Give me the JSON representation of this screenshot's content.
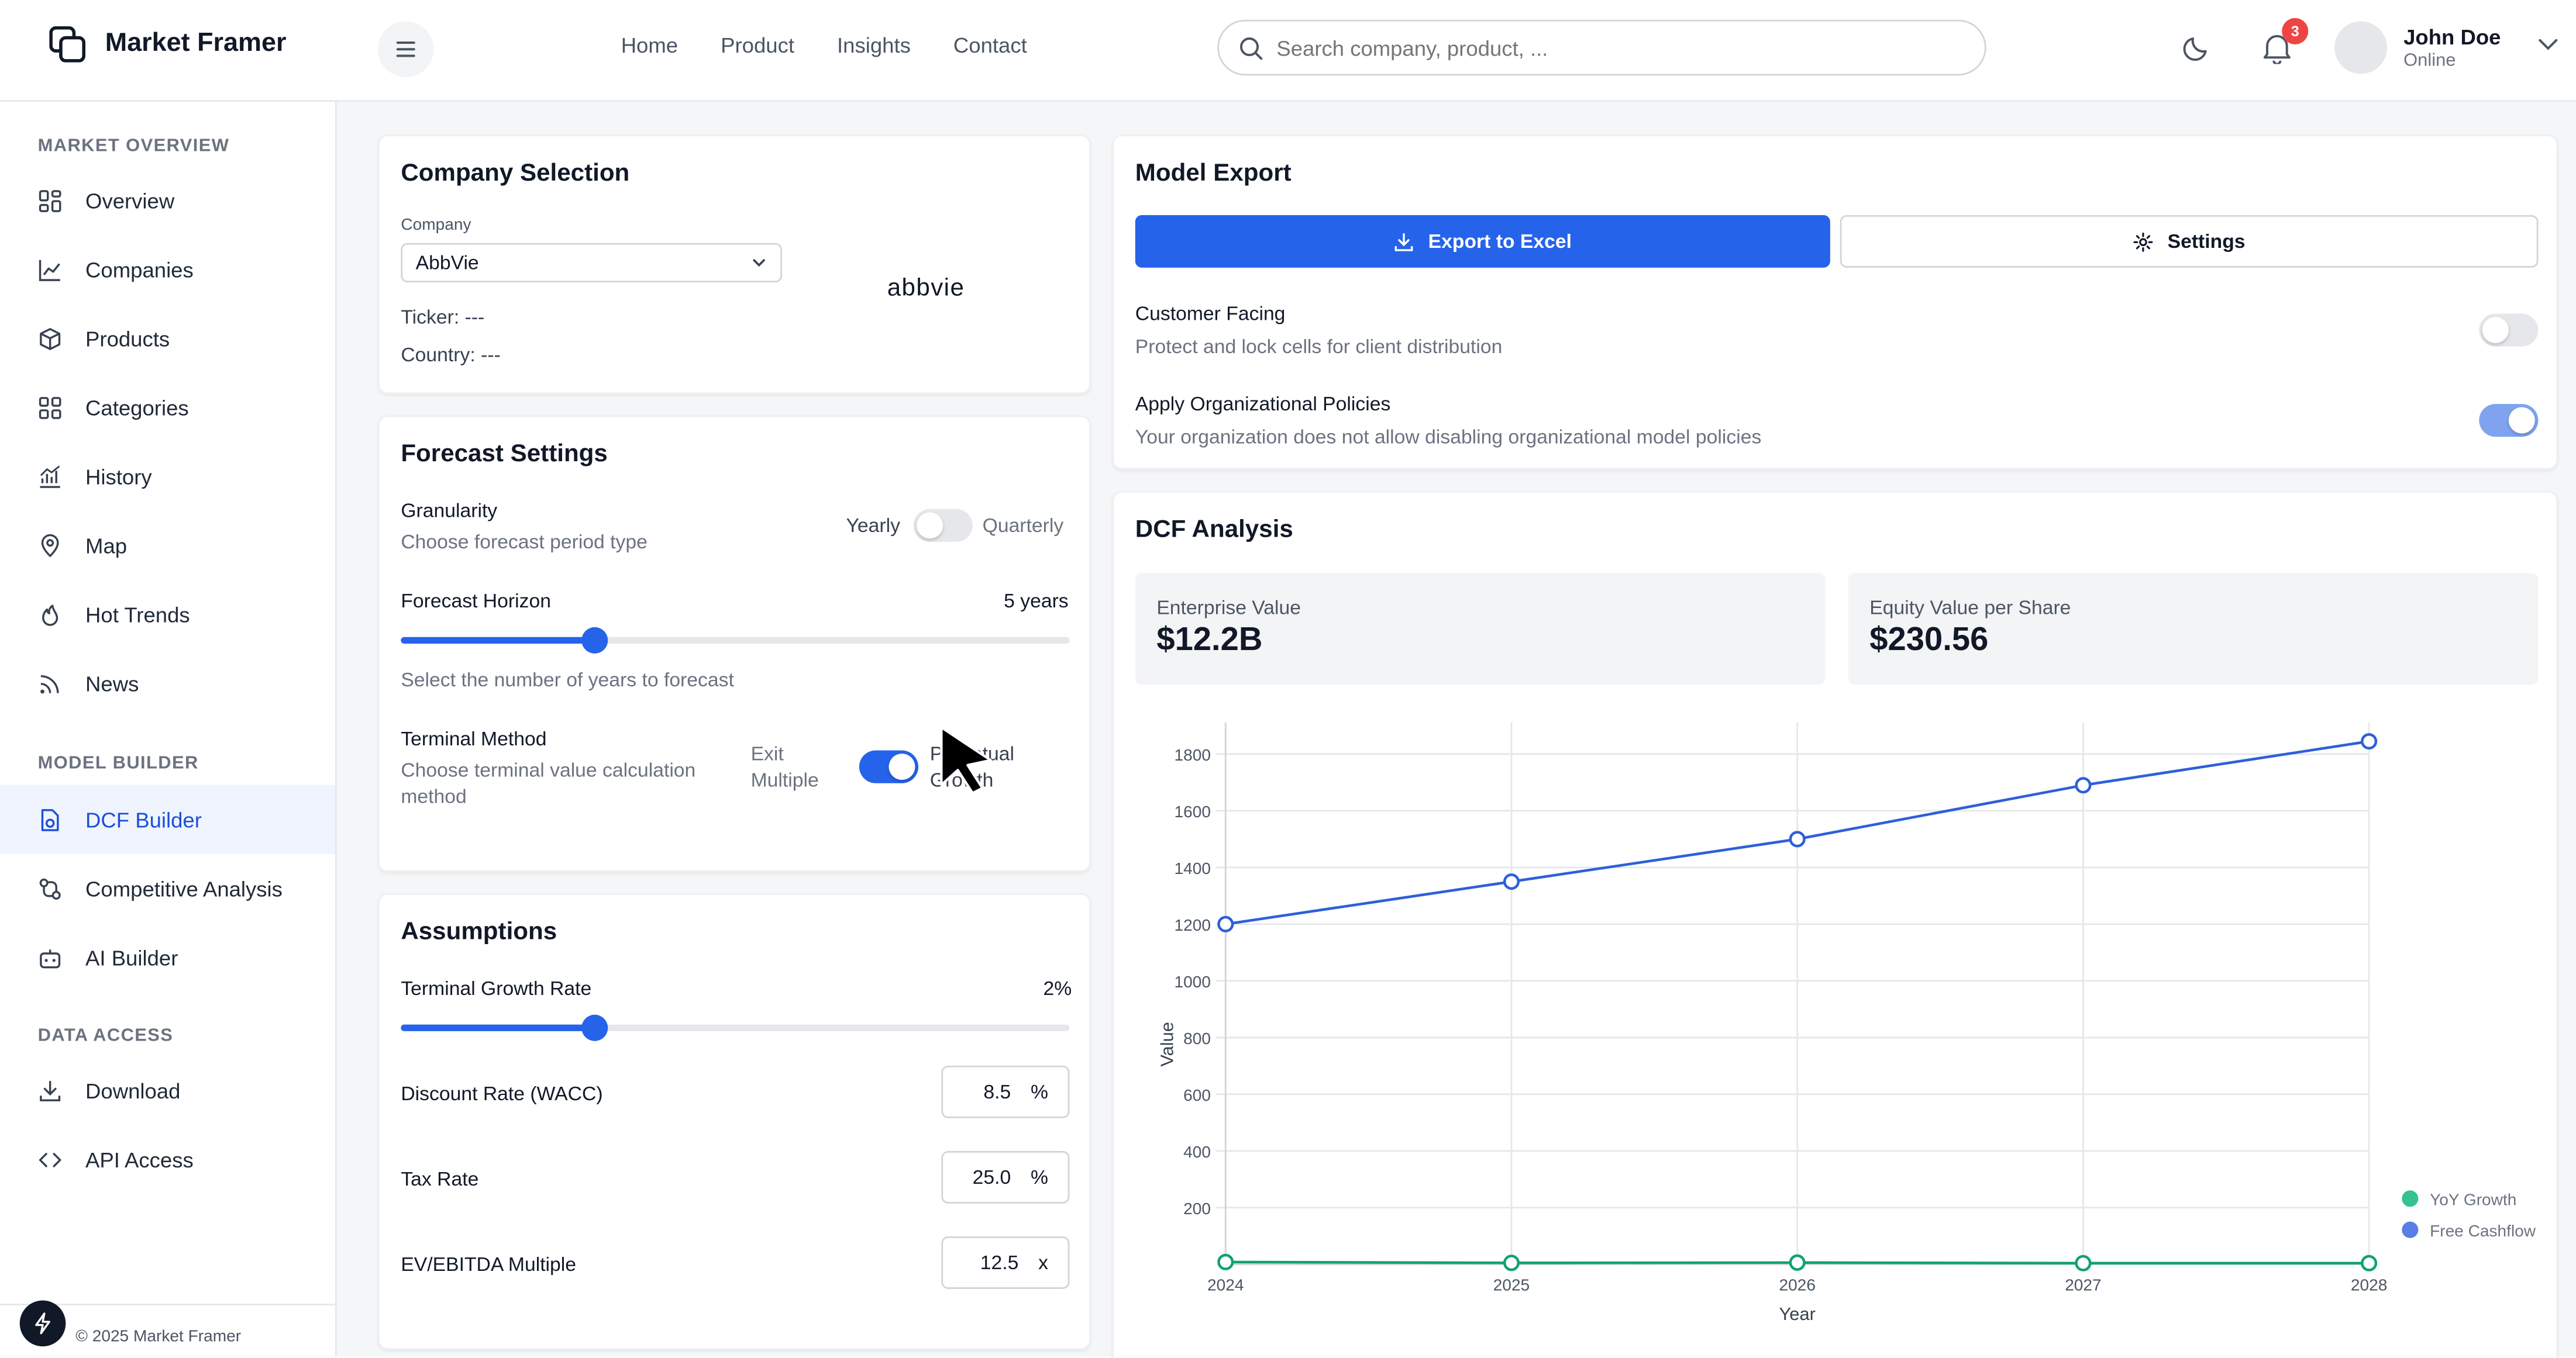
{
  "app": {
    "brand": "Market Framer",
    "nav": [
      "Home",
      "Product",
      "Insights",
      "Contact"
    ],
    "search_placeholder": "Search company, product, ...",
    "notifications_count": "3",
    "user": {
      "name": "John Doe",
      "status": "Online"
    }
  },
  "sidebar": {
    "sections": [
      {
        "title": "MARKET OVERVIEW",
        "items": [
          "Overview",
          "Companies",
          "Products",
          "Categories",
          "History",
          "Map",
          "Hot Trends",
          "News"
        ]
      },
      {
        "title": "MODEL BUILDER",
        "items": [
          "DCF Builder",
          "Competitive Analysis",
          "AI Builder"
        ]
      },
      {
        "title": "DATA ACCESS",
        "items": [
          "Download",
          "API Access"
        ]
      }
    ],
    "active_item": "DCF Builder",
    "copyright": "© 2025 Market Framer"
  },
  "company": {
    "title": "Company Selection",
    "label": "Company",
    "selected": "AbbVie",
    "logo_text": "abbvie",
    "ticker_label": "Ticker:",
    "ticker_value": "---",
    "country_label": "Country:",
    "country_value": "---"
  },
  "forecast": {
    "title": "Forecast Settings",
    "granularity_label": "Granularity",
    "granularity_sub": "Choose forecast period type",
    "opt_yearly": "Yearly",
    "opt_quarterly": "Quarterly",
    "horizon_label": "Forecast Horizon",
    "horizon_value": "5 years",
    "horizon_fraction": 0.29,
    "horizon_sub": "Select the number of years to forecast",
    "terminal_label": "Terminal Method",
    "terminal_sub_1": "Choose terminal value calculation",
    "terminal_sub_2": "method",
    "exit_1": "Exit",
    "exit_2": "Multiple",
    "perp_1": "Perpetual",
    "perp_2": "Growth"
  },
  "assumptions": {
    "title": "Assumptions",
    "tgr_label": "Terminal Growth Rate",
    "tgr_value": "2%",
    "tgr_fraction": 0.29,
    "wacc_label": "Discount Rate (WACC)",
    "wacc_value": "8.5",
    "wacc_unit": "%",
    "tax_label": "Tax Rate",
    "tax_value": "25.0",
    "tax_unit": "%",
    "ev_label": "EV/EBITDA Multiple",
    "ev_value": "12.5",
    "ev_unit": "x"
  },
  "export": {
    "title": "Model Export",
    "export_btn": "Export to Excel",
    "settings_btn": "Settings",
    "customer_label": "Customer Facing",
    "customer_sub": "Protect and lock cells for client distribution",
    "policies_label": "Apply Organizational Policies",
    "policies_sub": "Your organization does not allow disabling organizational model policies"
  },
  "dcf": {
    "title": "DCF Analysis",
    "ev_label": "Enterprise Value",
    "ev_value": "$12.2B",
    "eq_label": "Equity Value per Share",
    "eq_value": "$230.56"
  },
  "chart_data": {
    "type": "line",
    "x": [
      "2024",
      "2025",
      "2026",
      "2027",
      "2028"
    ],
    "series": [
      {
        "name": "Free Cashflow",
        "values": [
          1200,
          1350,
          1500,
          1690,
          1845
        ],
        "color": "#2d5fd8"
      },
      {
        "name": "YoY Growth",
        "values": [
          8,
          5,
          6,
          4,
          4
        ],
        "color": "#10a36c"
      }
    ],
    "xlabel": "Year",
    "ylabel": "Value",
    "yticks": [
      "200",
      "400",
      "600",
      "800",
      "1000",
      "1200",
      "1400",
      "1600",
      "1800"
    ],
    "ylim": [
      0,
      1900
    ],
    "legend": "bottom-right",
    "grid": true
  }
}
